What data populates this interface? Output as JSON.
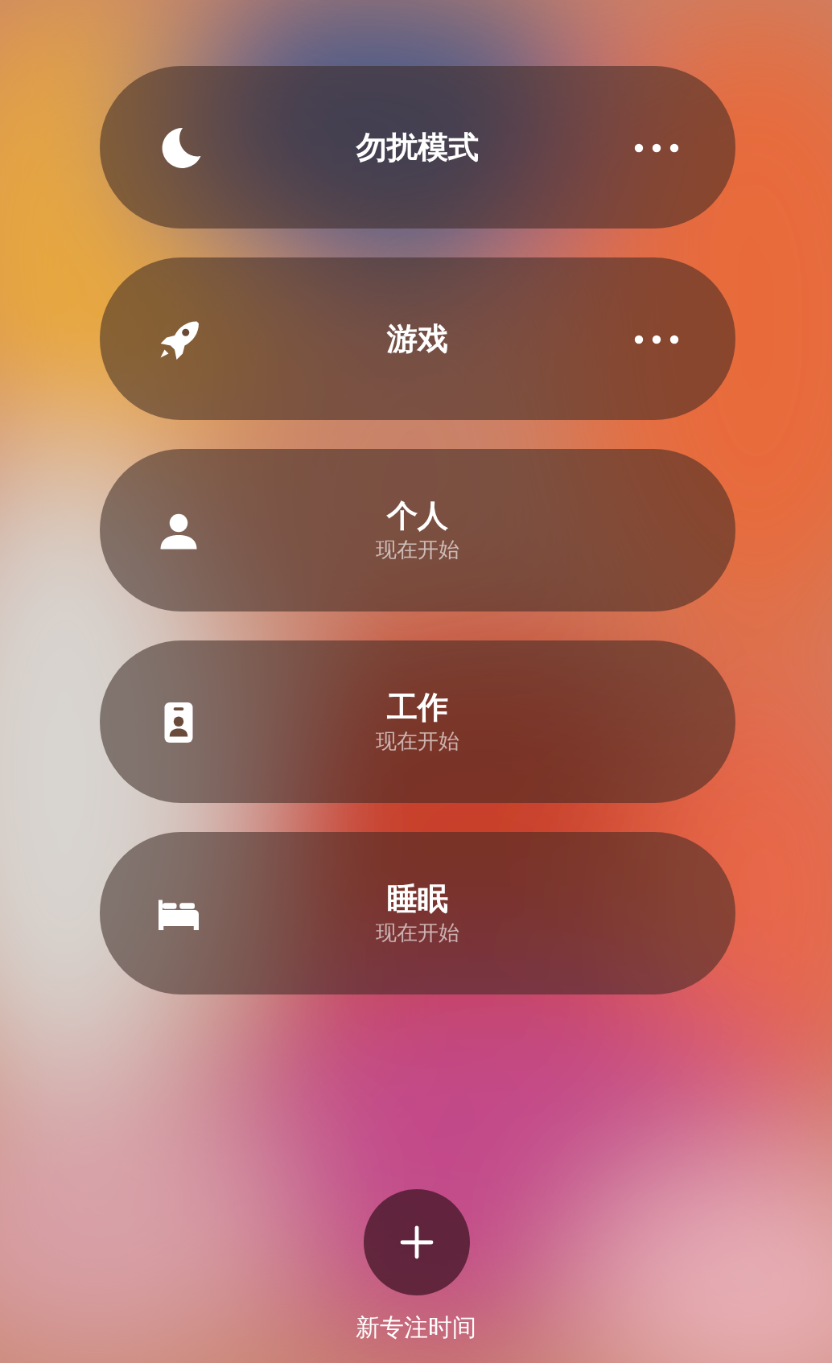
{
  "focus_modes": [
    {
      "kind": "moon",
      "label": "勿扰模式",
      "menu": true
    },
    {
      "kind": "rocket",
      "label": "游戏",
      "menu": true
    },
    {
      "kind": "person",
      "label": "个人",
      "subtitle": "现在开始",
      "menu": false
    },
    {
      "kind": "badge",
      "label": "工作",
      "subtitle": "现在开始",
      "menu": false
    },
    {
      "kind": "bed",
      "label": "睡眠",
      "subtitle": "现在开始",
      "menu": false
    }
  ],
  "add_button": {
    "label": "新专注时间"
  }
}
